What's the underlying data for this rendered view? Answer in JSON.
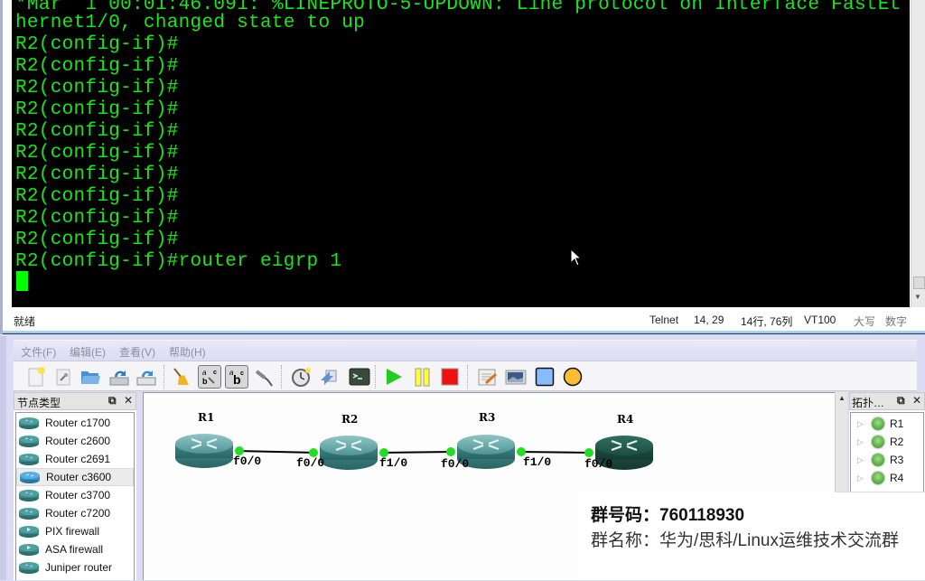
{
  "terminal": {
    "lines": [
      "*Mar  1 00:01:46.091: %LINEPROTO-5-UPDOWN: Line protocol on Interface FastEt",
      "hernet1/0, changed state to up",
      "R2(config-if)#",
      "R2(config-if)#",
      "R2(config-if)#",
      "R2(config-if)#",
      "R2(config-if)#",
      "R2(config-if)#",
      "R2(config-if)#",
      "R2(config-if)#",
      "R2(config-if)#",
      "R2(config-if)#",
      "R2(config-if)#router eigrp 1"
    ],
    "text_color": "#19e619",
    "background": "#000000"
  },
  "status_bar": {
    "ready": "就绪",
    "protocol": "Telnet",
    "cursor_pos": "14,  29",
    "rows_cols": "14行, 76列",
    "emulation": "VT100",
    "caps": "大写",
    "num": "数字"
  },
  "gns3": {
    "menu": [
      "文件(F)",
      "编辑(E)",
      "查看(V)",
      "帮助(H)"
    ],
    "toolbar": [
      {
        "name": "new-project-icon"
      },
      {
        "name": "open-config-icon"
      },
      {
        "name": "open-folder-icon"
      },
      {
        "name": "save-icon"
      },
      {
        "name": "save-as-icon"
      },
      {
        "name": "clear-broom-icon"
      },
      {
        "name": "show-interface-labels-icon",
        "pressed": true
      },
      {
        "name": "show-hostnames-icon",
        "pressed": true
      },
      {
        "name": "add-link-icon"
      },
      {
        "name": "snapshot-clock-icon"
      },
      {
        "name": "import-export-icon"
      },
      {
        "name": "console-all-icon"
      },
      {
        "name": "start-all-icon"
      },
      {
        "name": "suspend-all-icon"
      },
      {
        "name": "stop-all-icon"
      },
      {
        "name": "add-note-icon"
      },
      {
        "name": "insert-image-icon"
      },
      {
        "name": "draw-rectangle-icon"
      },
      {
        "name": "draw-ellipse-icon"
      }
    ],
    "node_dock": {
      "title": "节点类型",
      "items": [
        {
          "label": "Router c1700",
          "kind": "router"
        },
        {
          "label": "Router c2600",
          "kind": "router"
        },
        {
          "label": "Router c2691",
          "kind": "router"
        },
        {
          "label": "Router c3600",
          "kind": "router",
          "selected": true
        },
        {
          "label": "Router c3700",
          "kind": "router"
        },
        {
          "label": "Router c7200",
          "kind": "router"
        },
        {
          "label": "PIX firewall",
          "kind": "firewall"
        },
        {
          "label": "ASA firewall",
          "kind": "firewall"
        },
        {
          "label": "Juniper router",
          "kind": "router"
        }
      ]
    },
    "topology": {
      "routers": [
        {
          "name": "R1"
        },
        {
          "name": "R2"
        },
        {
          "name": "R3"
        },
        {
          "name": "R4",
          "dark": true
        }
      ],
      "links": [
        {
          "from": "R1",
          "from_port": "f0/0",
          "to": "R2",
          "to_port": "f0/0"
        },
        {
          "from": "R2",
          "from_port": "f1/0",
          "to": "R3",
          "to_port": "f0/0"
        },
        {
          "from": "R3",
          "from_port": "f1/0",
          "to": "R4",
          "to_port": "f0/0"
        }
      ],
      "link_status_color": "#22dd22"
    },
    "topo_dock": {
      "title": "拓扑…",
      "items": [
        "R1",
        "R2",
        "R3",
        "R4"
      ]
    }
  },
  "overlay": {
    "group_number": "群号码：760118930",
    "group_name": "群名称：华为/思科/Linux运维技术交流群"
  }
}
